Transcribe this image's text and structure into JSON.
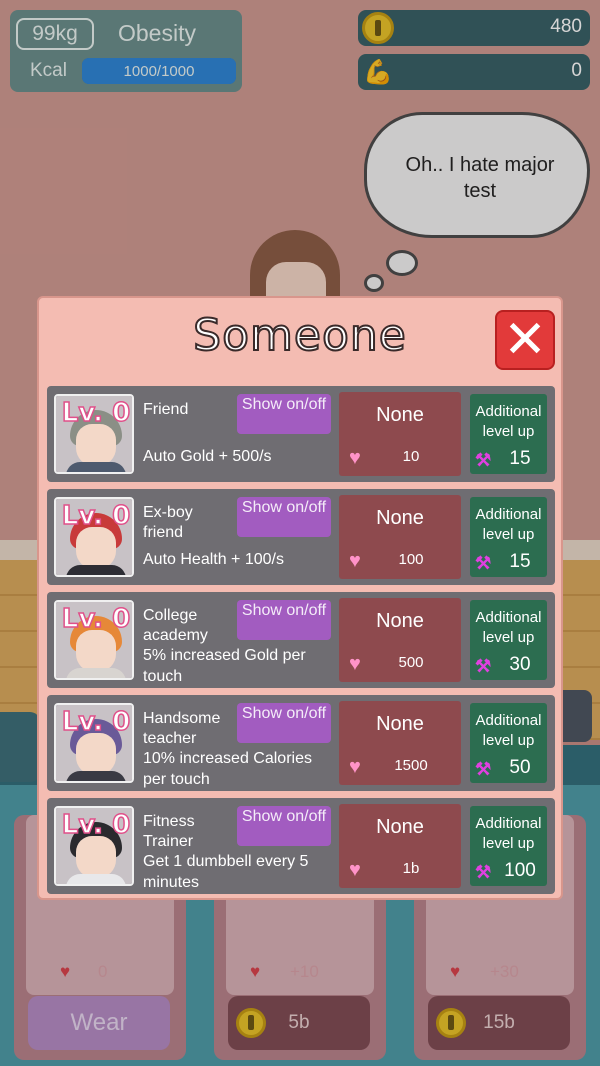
{
  "hud": {
    "weight": "99kg",
    "status": "Obesity",
    "kcal_label": "Kcal",
    "kcal_value": "1000/1000",
    "kcal_fraction": 1.0,
    "gold": "480",
    "power": "0"
  },
  "speech": {
    "text": "Oh.. I hate major test"
  },
  "dialog": {
    "title": "Someone",
    "close_icon": "close-icon",
    "rows": [
      {
        "level": "Lv. 0",
        "name": "Friend",
        "desc": "Auto Gold + 500/s",
        "show": "Show on/off",
        "status": "None",
        "heart_cost": "10",
        "level_label": "Additional level up",
        "dumbbell_cost": "15",
        "hair": "#8b8f86",
        "shirt": "#4e5a6e"
      },
      {
        "level": "Lv. 0",
        "name": "Ex-boy friend",
        "desc": "Auto Health + 100/s",
        "show": "Show on/off",
        "status": "None",
        "heart_cost": "100",
        "level_label": "Additional level up",
        "dumbbell_cost": "15",
        "hair": "#c83a3a",
        "shirt": "#2d2d34"
      },
      {
        "level": "Lv. 0",
        "name": "College academy",
        "desc": "5% increased Gold per touch",
        "show": "Show on/off",
        "status": "None",
        "heart_cost": "500",
        "level_label": "Additional level up",
        "dumbbell_cost": "30",
        "hair": "#e68838",
        "shirt": "#d8d4d0"
      },
      {
        "level": "Lv. 0",
        "name": "Handsome teacher",
        "desc": "10% increased Calories per touch",
        "show": "Show on/off",
        "status": "None",
        "heart_cost": "1500",
        "level_label": "Additional level up",
        "dumbbell_cost": "50",
        "hair": "#6a5a98",
        "shirt": "#3a3a44"
      },
      {
        "level": "Lv. 0",
        "name": "Fitness Trainer",
        "desc": "Get 1 dumbbell every 5 minutes",
        "show": "Show on/off",
        "status": "None",
        "heart_cost": "1b",
        "level_label": "Additional level up",
        "dumbbell_cost": "100",
        "hair": "#2a2a2e",
        "shirt": "#e8e8ea"
      }
    ]
  },
  "shop": {
    "items": [
      {
        "stat": "0",
        "button": "Wear"
      },
      {
        "stat": "+10",
        "button": "5b"
      },
      {
        "stat": "+30",
        "button": "15b"
      }
    ]
  },
  "colors": {
    "close_button": "#e23a3a",
    "show_button": "#a25cc0",
    "level_button": "#2c6d50",
    "none_box": "#8e4a4e",
    "row_bg": "#6f6d72",
    "dialog_bg": "#f4bcb2"
  }
}
